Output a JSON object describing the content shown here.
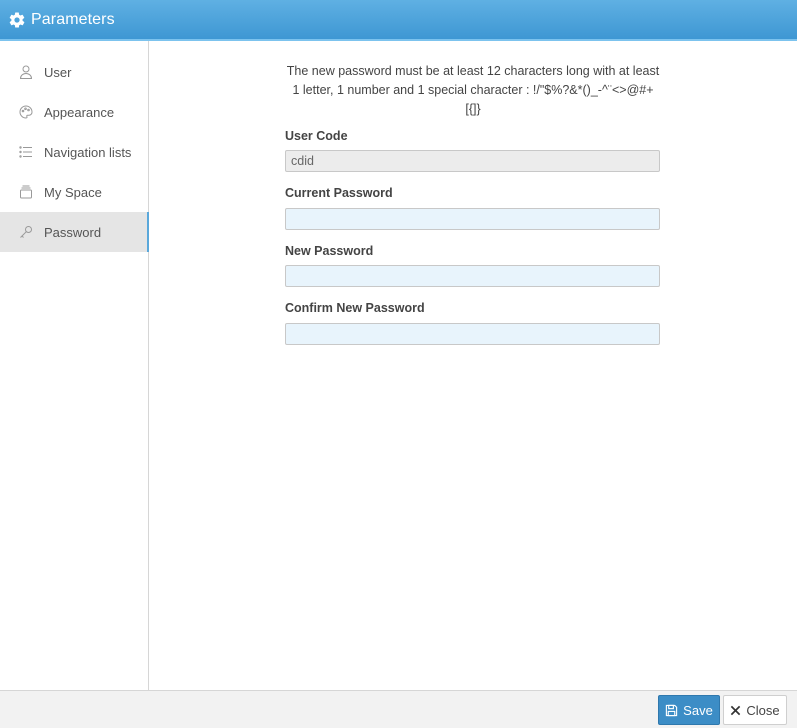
{
  "window": {
    "title": "Parameters",
    "icon": "gear-icon"
  },
  "sidebar": {
    "items": [
      {
        "label": "User",
        "icon": "user-icon"
      },
      {
        "label": "Appearance",
        "icon": "palette-icon"
      },
      {
        "label": "Navigation lists",
        "icon": "list-icon"
      },
      {
        "label": "My Space",
        "icon": "folder-stack-icon"
      },
      {
        "label": "Password",
        "icon": "key-icon",
        "active": true
      }
    ]
  },
  "main": {
    "rule_line1": "The new password must be at least 12 characters long with at least",
    "rule_line2": "1 letter, 1 number and 1 special character : !/\"$%?&*()_-^¨<>@#+[{]}",
    "fields": {
      "user_code": {
        "label": "User Code",
        "value": "cdid"
      },
      "current_password": {
        "label": "Current Password",
        "value": ""
      },
      "new_password": {
        "label": "New Password",
        "value": ""
      },
      "confirm_password": {
        "label": "Confirm New Password",
        "value": ""
      }
    }
  },
  "footer": {
    "save_label": "Save",
    "close_label": "Close"
  },
  "colors": {
    "accent": "#3c8dc6",
    "titlebar": "#4aa3db",
    "input_bg": "#e8f4fc"
  }
}
